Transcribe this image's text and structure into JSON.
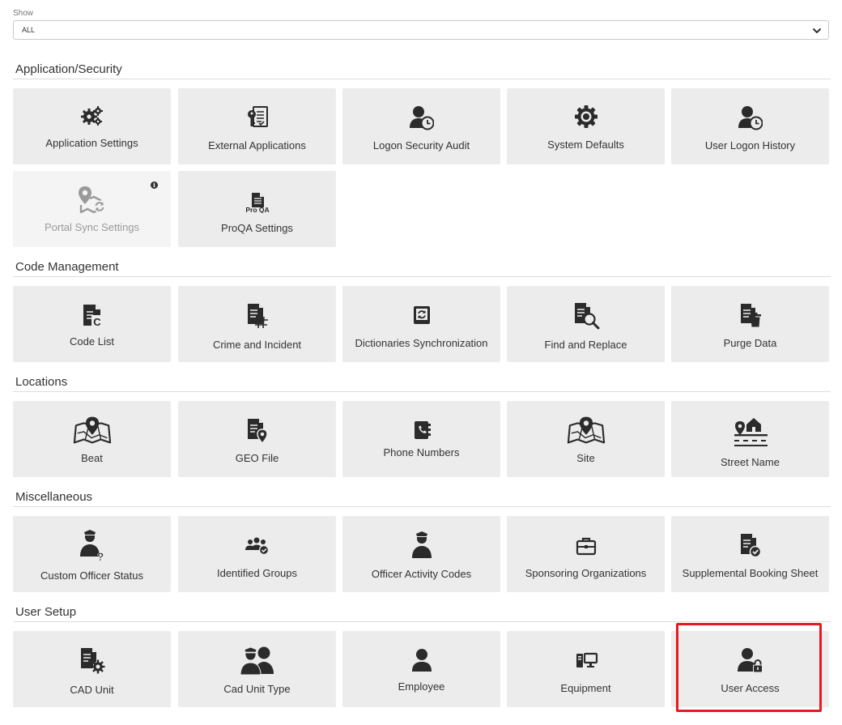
{
  "filter": {
    "label": "Show",
    "value": "ALL"
  },
  "sections": {
    "app": {
      "title": "Application/Security",
      "tiles": [
        "Application Settings",
        "External Applications",
        "Logon Security Audit",
        "System Defaults",
        "User Logon History",
        "Portal Sync Settings",
        "ProQA Settings"
      ]
    },
    "code": {
      "title": "Code Management",
      "tiles": [
        "Code List",
        "Crime and Incident",
        "Dictionaries Synchronization",
        "Find and Replace",
        "Purge Data"
      ]
    },
    "loc": {
      "title": "Locations",
      "tiles": [
        "Beat",
        "GEO File",
        "Phone Numbers",
        "Site",
        "Street Name"
      ]
    },
    "misc": {
      "title": "Miscellaneous",
      "tiles": [
        "Custom Officer Status",
        "Identified Groups",
        "Officer Activity Codes",
        "Sponsoring Organizations",
        "Supplemental Booking Sheet"
      ]
    },
    "user": {
      "title": "User Setup",
      "tiles": [
        "CAD Unit",
        "Cad Unit Type",
        "Employee",
        "Equipment",
        "User Access"
      ]
    }
  },
  "icons": {
    "application_settings": "gears-icon",
    "external_applications": "key-document-icon",
    "logon_security_audit": "user-clock-icon",
    "system_defaults": "gear-icon",
    "user_logon_history": "user-clock-icon",
    "portal_sync_settings": "map-sync-icon",
    "proqa_settings": "proqa-document-icon",
    "proqa_text": "Pro QA",
    "code_list": "code-document-icon",
    "crime_and_incident": "hash-document-icon",
    "dictionaries_synchronization": "sync-book-icon",
    "find_and_replace": "search-document-icon",
    "purge_data": "trash-document-icon",
    "beat": "map-pin-icon",
    "geo_file": "geo-document-icon",
    "phone_numbers": "phone-book-icon",
    "site": "map-pin-icon",
    "street_name": "street-house-icon",
    "custom_officer_status": "officer-question-icon",
    "identified_groups": "group-check-icon",
    "officer_activity_codes": "officer-icon",
    "sponsoring_organizations": "briefcase-icon",
    "supplemental_booking_sheet": "check-document-icon",
    "cad_unit": "gear-document-icon",
    "cad_unit_type": "officers-icon",
    "employee": "user-icon",
    "equipment": "computer-icon",
    "user_access": "user-lock-icon"
  },
  "colors": {
    "tile_background": "#ececec",
    "icon": "#2b2b2b",
    "highlight": "#e8191f"
  }
}
